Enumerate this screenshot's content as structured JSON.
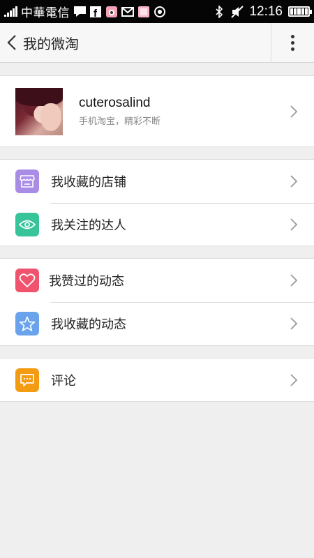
{
  "status_bar": {
    "carrier": "中華電信",
    "time": "12:16",
    "icons": [
      "signal-icon",
      "message-icon",
      "facebook-icon",
      "camera-icon",
      "mail-icon",
      "photo-icon",
      "sync-icon",
      "bluetooth-icon",
      "mute-icon",
      "battery-icon"
    ]
  },
  "header": {
    "title": "我的微淘",
    "back_icon": "chevron-left-icon",
    "more_icon": "more-vertical-icon"
  },
  "profile": {
    "name": "cuterosalind",
    "subtitle": "手机淘宝，精彩不断"
  },
  "groups": [
    [
      {
        "label": "我收藏的店铺",
        "icon": "store-icon",
        "color": "#a98ce6"
      },
      {
        "label": "我关注的达人",
        "icon": "eye-icon",
        "color": "#38c49b"
      }
    ],
    [
      {
        "label": "我赞过的动态",
        "icon": "heart-icon",
        "color": "#f0536e"
      },
      {
        "label": "我收藏的动态",
        "icon": "star-icon",
        "color": "#6aa3ec"
      }
    ],
    [
      {
        "label": "评论",
        "icon": "comment-icon",
        "color": "#f39b13"
      }
    ]
  ]
}
